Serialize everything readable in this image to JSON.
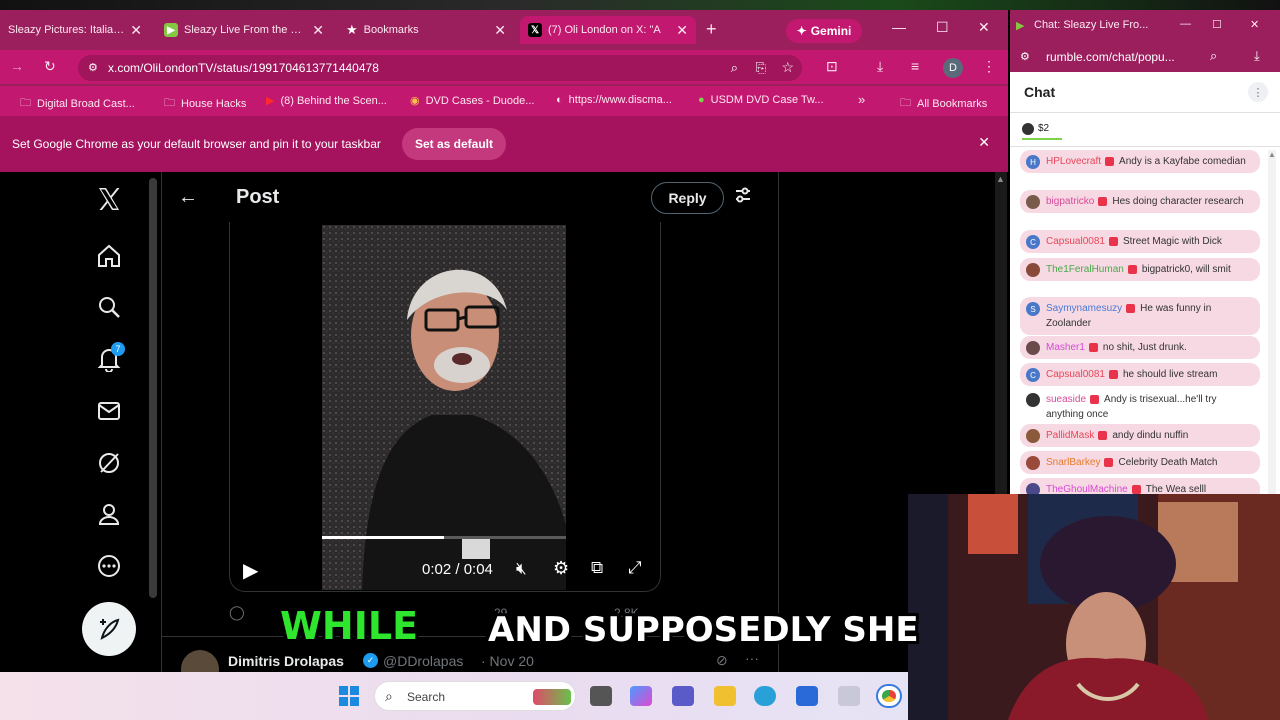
{
  "browser": {
    "tabs": [
      {
        "title": "Sleazy Pictures: Italians"
      },
      {
        "title": "Sleazy Live From the B..."
      },
      {
        "title": "Bookmarks"
      },
      {
        "title": "(7) Oli London on X: \"A"
      }
    ],
    "gemini_label": "Gemini",
    "url": "x.com/OliLondonTV/status/1991704613771440478",
    "account_initial": "D",
    "bookmarks": [
      "Digital Broad Cast...",
      "House Hacks",
      "(8) Behind the Scen...",
      "DVD Cases - Duode...",
      "https://www.discma...",
      "USDM DVD Case Tw...",
      "All Bookmarks"
    ],
    "infobar_text": "Set Google Chrome as your default browser and pin it to your taskbar",
    "set_default_label": "Set as default"
  },
  "x": {
    "header_title": "Post",
    "reply_label": "Reply",
    "notifications_count": "7",
    "video_time": "0:02 / 0:04",
    "video_progress": 0.5,
    "stats_left": "29",
    "stats_right": "2.8K",
    "next_reply": {
      "name": "Dimitris Drolapas",
      "handle": "@DDrolapas",
      "date": "· Nov 20"
    }
  },
  "chat_window": {
    "tab_title": "Chat: Sleazy Live Fro...",
    "url": "rumble.com/chat/popu...",
    "header": "Chat",
    "pinned_amount": "$2",
    "messages": [
      {
        "user": "HPLovecraft",
        "text": "Andy is a Kayfabe comedian",
        "color": "#e8475a",
        "avatar": "#4a78c8",
        "initial": "H",
        "tinted": true
      },
      {
        "user": "bigpatricko",
        "text": "Hes doing character research",
        "color": "#d74a9a",
        "avatar": "#7a5a4a",
        "initial": "",
        "tinted": true
      },
      {
        "user": "Capsual0081",
        "text": "Street Magic with Dick",
        "color": "#e8475a",
        "avatar": "#4a78c8",
        "initial": "C",
        "tinted": true
      },
      {
        "user": "The1FeralHuman",
        "text": "bigpatrick0, will smit",
        "color": "#4aa84a",
        "avatar": "#8a4a3a",
        "initial": "",
        "tinted": true
      },
      {
        "user": "Saymynamesuzy",
        "text": "He was funny in Zoolander",
        "color": "#4a7ad8",
        "avatar": "#4a78c8",
        "initial": "S",
        "tinted": true
      },
      {
        "user": "Masher1",
        "text": "no shit, Just drunk.",
        "color": "#d74ad8",
        "avatar": "#6a4a4a",
        "initial": "",
        "tinted": true
      },
      {
        "user": "Capsual0081",
        "text": "he should live stream",
        "color": "#e8475a",
        "avatar": "#4a78c8",
        "initial": "C",
        "tinted": true
      },
      {
        "user": "sueaside",
        "text": "Andy is trisexual...he'll try anything once",
        "color": "#d74a9a",
        "avatar": "#333333",
        "initial": "",
        "tinted": false
      },
      {
        "user": "PallidMask",
        "text": "andy dindu nuffin",
        "color": "#e8475a",
        "avatar": "#8a5a3a",
        "initial": "",
        "tinted": true
      },
      {
        "user": "SnarlBarkey",
        "text": "Celebrity Death Match",
        "color": "#e87a2a",
        "avatar": "#9a4a3a",
        "initial": "",
        "tinted": true
      },
      {
        "user": "TheGhoulMachine",
        "text": "The Wea selll",
        "color": "#d74ad8",
        "avatar": "#4a4a8a",
        "initial": "",
        "tinted": true
      }
    ]
  },
  "taskbar": {
    "search_placeholder": "Search"
  },
  "caption": {
    "highlight_word": "WHILE",
    "rest": "AND SUPPOSEDLY SHE"
  },
  "colors": {
    "chrome_theme": "#c3186f",
    "x_accent": "#1d9bf0",
    "caption_highlight": "#2ee62e"
  }
}
